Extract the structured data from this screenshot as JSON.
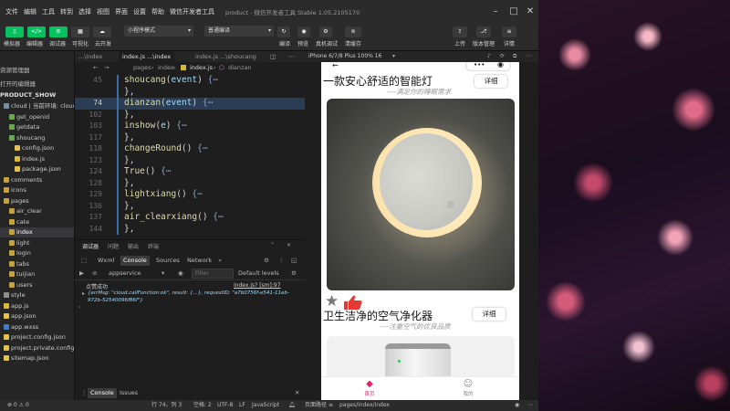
{
  "title_bar": {
    "menus": [
      "文件",
      "编辑",
      "工具",
      "转到",
      "选择",
      "视图",
      "界面",
      "设置",
      "帮助",
      "微信开发者工具"
    ],
    "window_title": "product - 微信开发者工具 Stable 1.05.2105170"
  },
  "toolbar": {
    "left_labels": [
      "模拟器",
      "编辑器",
      "调试器",
      "可视化",
      "云开发"
    ],
    "mode_select": "小程序模式",
    "compile_select": "普通编译",
    "mid_labels": [
      "编译",
      "预览",
      "真机调试",
      "清缓存"
    ],
    "right_labels": [
      "上传",
      "版本管理",
      "详情"
    ]
  },
  "explorer": {
    "header": "资源管理器",
    "open_editors": "打开的编辑器",
    "project": "PRODUCT_SHOW",
    "items": [
      {
        "label": "cloud | 当前环境: cloud1",
        "icon": "cloud",
        "depth": 0
      },
      {
        "label": "get_openid",
        "icon": "green",
        "depth": 1
      },
      {
        "label": "getdata",
        "icon": "green",
        "depth": 1
      },
      {
        "label": "shoucang",
        "icon": "green",
        "depth": 1
      },
      {
        "label": "config.json",
        "icon": "json",
        "depth": 2
      },
      {
        "label": "index.js",
        "icon": "js",
        "depth": 2
      },
      {
        "label": "package.json",
        "icon": "json",
        "depth": 2
      },
      {
        "label": "comments",
        "icon": "folder",
        "depth": 0
      },
      {
        "label": "icons",
        "icon": "folder",
        "depth": 0
      },
      {
        "label": "pages",
        "icon": "folder",
        "depth": 0
      },
      {
        "label": "air_clear",
        "icon": "folder",
        "depth": 1
      },
      {
        "label": "cate",
        "icon": "folder",
        "depth": 1
      },
      {
        "label": "index",
        "icon": "folder",
        "depth": 1,
        "selected": true
      },
      {
        "label": "light",
        "icon": "folder",
        "depth": 1
      },
      {
        "label": "login",
        "icon": "folder",
        "depth": 1
      },
      {
        "label": "tabs",
        "icon": "folder",
        "depth": 1
      },
      {
        "label": "tuijian",
        "icon": "folder",
        "depth": 1
      },
      {
        "label": "users",
        "icon": "folder",
        "depth": 1
      },
      {
        "label": "style",
        "icon": "style",
        "depth": 0
      },
      {
        "label": "app.js",
        "icon": "js",
        "depth": 0
      },
      {
        "label": "app.json",
        "icon": "json",
        "depth": 0
      },
      {
        "label": "app.wxss",
        "icon": "wxss",
        "depth": 0
      },
      {
        "label": "project.config.json",
        "icon": "json",
        "depth": 0
      },
      {
        "label": "project.private.config.json",
        "icon": "json",
        "depth": 0
      },
      {
        "label": "sitemap.json",
        "icon": "json",
        "depth": 0
      }
    ]
  },
  "editor": {
    "tabs": [
      "...\\index",
      "index.js ...\\index",
      "index.js ...\\shoucang"
    ],
    "breadcrumb": [
      "pages",
      "index",
      "index.js",
      "dianzan"
    ],
    "lines": [
      {
        "num": "45",
        "name": "shoucang",
        "params": "event",
        "folded": true
      },
      {
        "num": "",
        "name": "},",
        "params": null,
        "folded": false
      },
      {
        "num": "74",
        "name": "dianzan",
        "params": "event",
        "folded": true,
        "current": true
      },
      {
        "num": "102",
        "name": "},",
        "params": null,
        "folded": false
      },
      {
        "num": "103",
        "name": "inshow",
        "params": "e",
        "folded": true
      },
      {
        "num": "117",
        "name": "},",
        "params": null,
        "folded": false
      },
      {
        "num": "118",
        "name": "changeRound",
        "params": "",
        "folded": true
      },
      {
        "num": "123",
        "name": "},",
        "params": null,
        "folded": false
      },
      {
        "num": "124",
        "name": "True",
        "params": "",
        "folded": true
      },
      {
        "num": "128",
        "name": "},",
        "params": null,
        "folded": false
      },
      {
        "num": "129",
        "name": "lightxiang",
        "params": "",
        "folded": true
      },
      {
        "num": "136",
        "name": "},",
        "params": null,
        "folded": false
      },
      {
        "num": "137",
        "name": "air_clearxiang",
        "params": "",
        "folded": true
      },
      {
        "num": "144",
        "name": "},",
        "params": null,
        "folded": false
      }
    ],
    "fold_glyph": "{⋯"
  },
  "panel": {
    "top_tabs": [
      "调试器",
      "问题",
      "输出",
      "终端"
    ],
    "devtools_tabs": [
      "Wxml",
      "Console",
      "Sources",
      "Network"
    ],
    "context": "appservice",
    "filter_placeholder": "Filter",
    "levels": "Default levels",
    "log_label": "点赞成功",
    "log_source": "index.js? [sm]:97",
    "log_body": "{errMsg: \"cloud.callFunction:ok\", result: {…}, requestID: \"a7b0756f-e541-11eb-972b-52540096f86f\"}",
    "bottom_tabs": [
      "Console",
      "Issues"
    ]
  },
  "status_bar": {
    "left": "⊗ 0 ⚠ 0",
    "position": "行 74，列 3",
    "spaces": "空格: 2",
    "encoding": "UTF-8",
    "eol": "LF",
    "language": "JavaScript",
    "page_path_label": "页面路径",
    "page_path": "pages/index/index"
  },
  "simulator": {
    "device": "iPhone 6/7/8 Plus 100% 16",
    "products": [
      {
        "title": "一款安心舒适的智能灯",
        "subtitle": "----满足你的睡眠需求",
        "button": "详细"
      },
      {
        "title": "卫生洁净的空气净化器",
        "subtitle": "----注重空气的优良品质",
        "button": "详细"
      }
    ],
    "tabbar": [
      {
        "label": "首页",
        "active": true
      },
      {
        "label": "我的",
        "active": false
      }
    ]
  },
  "colors": {
    "accent_green": "#07c160",
    "thumb_red": "#e53935",
    "tab_active": "#e91e63"
  }
}
